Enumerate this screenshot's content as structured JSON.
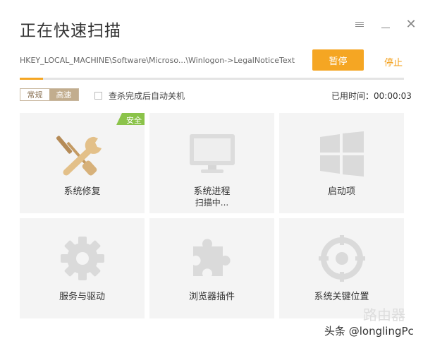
{
  "window": {
    "title": "正在快速扫描",
    "menu_icon": "menu-lines-icon",
    "minimize_icon": "minimize-icon",
    "close_icon": "close-icon",
    "close_glyph": "✕"
  },
  "scan": {
    "current_path": "HKEY_LOCAL_MACHINE\\Software\\Microso...\\Winlogon->LegalNoticeText",
    "pause_label": "暂停",
    "stop_label": "停止",
    "progress_percent": 6,
    "accent_color": "#f5a623"
  },
  "options": {
    "mode_normal": "常规",
    "mode_fast": "高速",
    "selected_mode": "高速",
    "shutdown_label": "查杀完成后自动关机",
    "shutdown_checked": false,
    "elapsed_label": "已用时间：00:00:03"
  },
  "tiles": [
    {
      "label": "系统修复",
      "icon": "wrench-screwdriver-icon",
      "badge": "安全",
      "badge_color": "#8bc34a",
      "active": true
    },
    {
      "label": "系统进程",
      "sublabel": "扫描中...",
      "icon": "monitor-icon",
      "active": false
    },
    {
      "label": "启动项",
      "icon": "windows-logo-icon",
      "active": false
    },
    {
      "label": "服务与驱动",
      "icon": "gear-icon",
      "active": false
    },
    {
      "label": "浏览器插件",
      "icon": "puzzle-icon",
      "active": false
    },
    {
      "label": "系统关键位置",
      "icon": "crosshair-icon",
      "active": false
    }
  ],
  "watermark": {
    "text": "头条 @longlingPc",
    "logo_text": "路由器"
  }
}
